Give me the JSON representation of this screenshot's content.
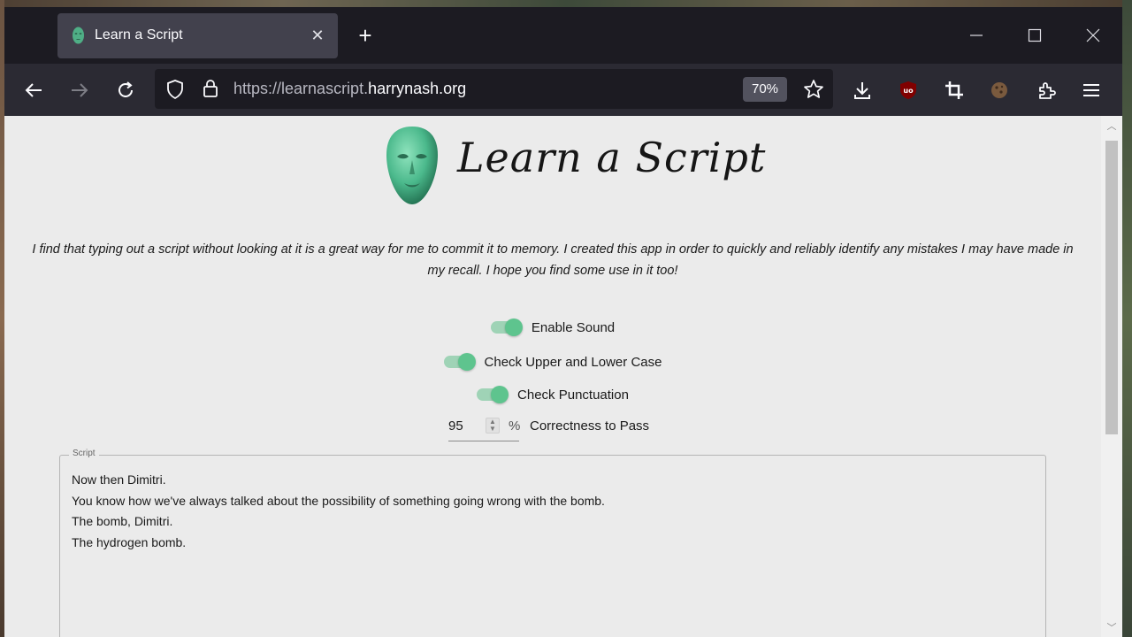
{
  "browser": {
    "tab_title": "Learn a Script",
    "url_prefix": "https://learnascript.",
    "url_domain": "harrynash.org",
    "zoom": "70%"
  },
  "page": {
    "logo_text": "Learn a Script",
    "intro": "I find that typing out a script without looking at it is a great way for me to commit it to memory. I created this app in order to quickly and reliably identify any mistakes I may have made in my recall. I hope you find some use in it too!",
    "toggles": [
      {
        "label": "Enable Sound",
        "on": true
      },
      {
        "label": "Check Upper and Lower Case",
        "on": true
      },
      {
        "label": "Check Punctuation",
        "on": true
      }
    ],
    "correctness": {
      "value": "95",
      "unit": "%",
      "label": "Correctness to Pass"
    },
    "script": {
      "legend": "Script",
      "lines": [
        "Now then Dimitri.",
        "You know how we've always talked about the possibility of something going wrong with the bomb.",
        "The bomb, Dimitri.",
        "The hydrogen bomb."
      ]
    }
  },
  "colors": {
    "accent_green": "#5ec48e",
    "track_green": "#9fd3b6",
    "toolbar_bg": "#2b2a33",
    "tabstrip_bg": "#1c1b22",
    "page_bg": "#ebebeb"
  }
}
